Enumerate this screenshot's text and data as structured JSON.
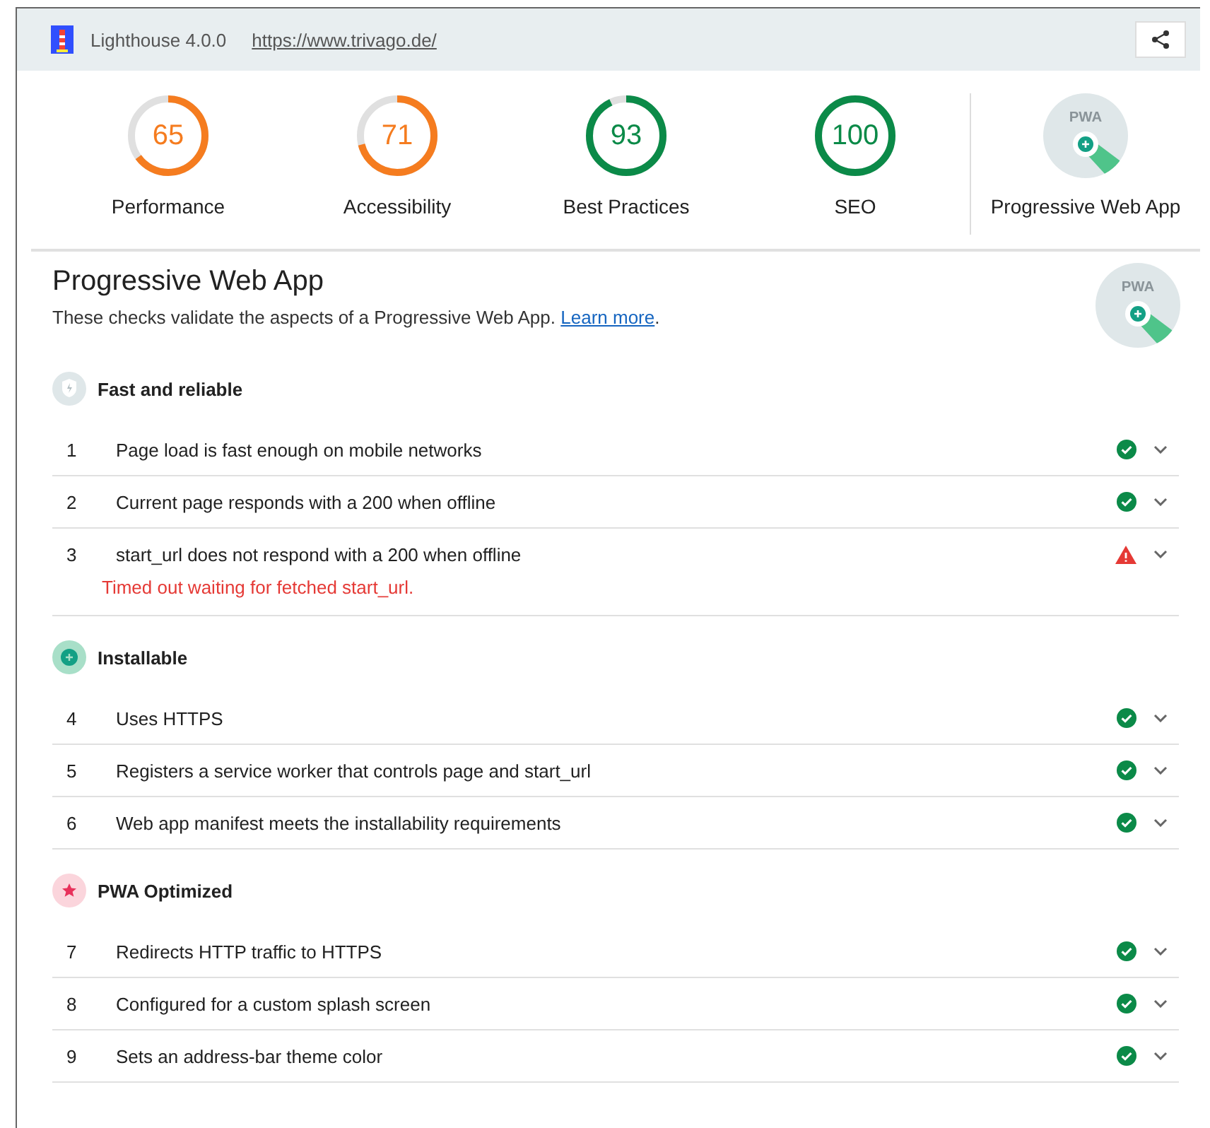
{
  "header": {
    "title": "Lighthouse 4.0.0",
    "url": "https://www.trivago.de/"
  },
  "gauges": [
    {
      "score": "65",
      "label": "Performance"
    },
    {
      "score": "71",
      "label": "Accessibility"
    },
    {
      "score": "93",
      "label": "Best Practices"
    },
    {
      "score": "100",
      "label": "SEO"
    }
  ],
  "pwa_gauge": {
    "badge_text": "PWA",
    "label": "Progressive Web App"
  },
  "section": {
    "title": "Progressive Web App",
    "description": "These checks validate the aspects of a Progressive Web App.",
    "link": "Learn more",
    "after_link": ".",
    "badge_text": "PWA"
  },
  "groups": [
    {
      "kind": "lightning",
      "title": "Fast and reliable",
      "audits": [
        {
          "number": "1",
          "title": "Page load is fast enough on mobile networks",
          "kind": "pass"
        },
        {
          "number": "2",
          "title": "Current page responds with a 200 when offline",
          "kind": "pass"
        },
        {
          "number": "3",
          "title": "start_url does not respond with a 200 when offline",
          "kind": "fail",
          "error": "Timed out waiting for fetched start_url."
        }
      ]
    },
    {
      "kind": "plus",
      "title": "Installable",
      "audits": [
        {
          "number": "4",
          "title": "Uses HTTPS",
          "kind": "pass"
        },
        {
          "number": "5",
          "title": "Registers a service worker that controls page and start_url",
          "kind": "pass"
        },
        {
          "number": "6",
          "title": "Web app manifest meets the installability requirements",
          "kind": "pass"
        }
      ]
    },
    {
      "kind": "star",
      "title": "PWA Optimized",
      "audits": [
        {
          "number": "7",
          "title": "Redirects HTTP traffic to HTTPS",
          "kind": "pass"
        },
        {
          "number": "8",
          "title": "Configured for a custom splash screen",
          "kind": "pass"
        },
        {
          "number": "9",
          "title": "Sets an address-bar theme color",
          "kind": "pass"
        }
      ]
    }
  ]
}
